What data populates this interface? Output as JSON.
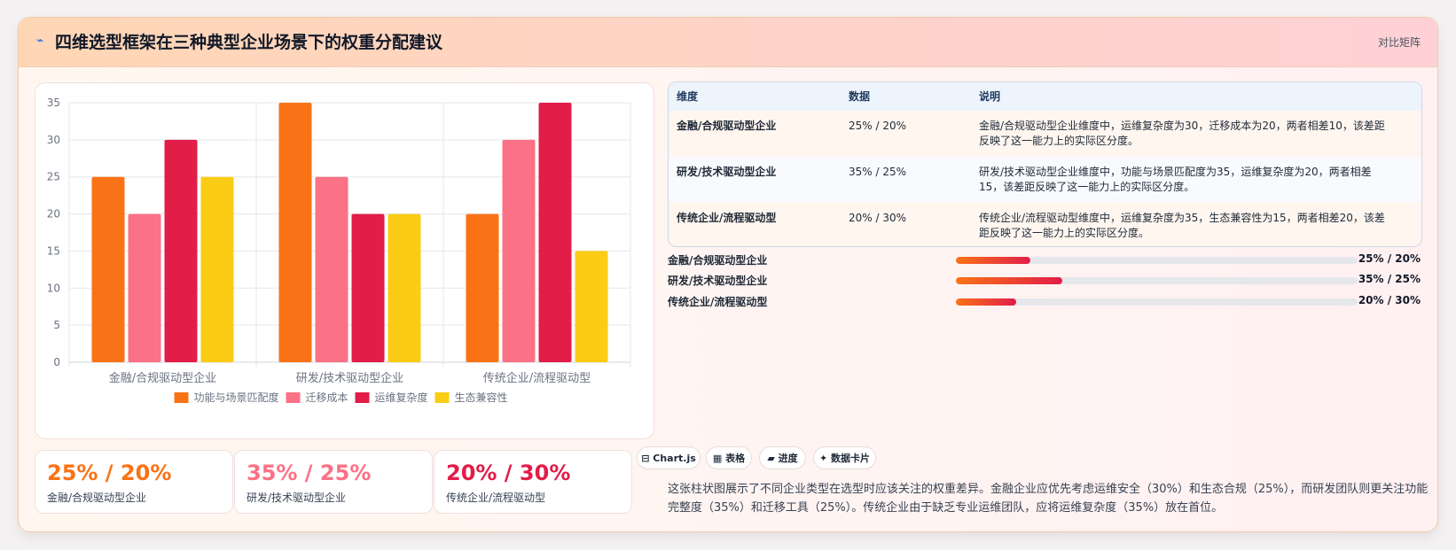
{
  "header": {
    "icon": "⌁",
    "title": "四维选型框架在三种典型企业场景下的权重分配建议",
    "tag": "对比矩阵"
  },
  "colors": {
    "orange": "#f97316",
    "pink": "#fb7185",
    "crimson": "#e11d48",
    "yellow": "#facc15"
  },
  "chart_data": {
    "type": "bar",
    "categories": [
      "金融/合规驱动型企业",
      "研发/技术驱动型企业",
      "传统企业/流程驱动型"
    ],
    "series": [
      {
        "name": "功能与场景匹配度",
        "values": [
          25,
          35,
          20
        ],
        "color": "#f97316"
      },
      {
        "name": "迁移成本",
        "values": [
          20,
          25,
          30
        ],
        "color": "#fb7185"
      },
      {
        "name": "运维复杂度",
        "values": [
          30,
          20,
          35
        ],
        "color": "#e11d48"
      },
      {
        "name": "生态兼容性",
        "values": [
          25,
          20,
          15
        ],
        "color": "#facc15"
      }
    ],
    "ylim": [
      0,
      35
    ],
    "yticks": [
      0,
      5,
      10,
      15,
      20,
      25,
      30,
      35
    ],
    "legend": "bottom",
    "grid": true
  },
  "kpis": [
    {
      "value": "25% / 20%",
      "label": "金融/合规驱动型企业",
      "color": "#f97316"
    },
    {
      "value": "35% / 25%",
      "label": "研发/技术驱动型企业",
      "color": "#fb7185"
    },
    {
      "value": "20% / 30%",
      "label": "传统企业/流程驱动型",
      "color": "#e11d48"
    }
  ],
  "table": {
    "headers": [
      "维度",
      "数据",
      "说明"
    ],
    "rows": [
      {
        "dim": "金融/合规驱动型企业",
        "data": "25% / 20%",
        "desc": "金融/合规驱动型企业维度中，运维复杂度为30，迁移成本为20，两者相差10，该差距反映了这一能力上的实际区分度。"
      },
      {
        "dim": "研发/技术驱动型企业",
        "data": "35% / 25%",
        "desc": "研发/技术驱动型企业维度中，功能与场景匹配度为35，运维复杂度为20，两者相差15，该差距反映了这一能力上的实际区分度。"
      },
      {
        "dim": "传统企业/流程驱动型",
        "data": "20% / 30%",
        "desc": "传统企业/流程驱动型维度中，运维复杂度为35，生态兼容性为15，两者相差20，该差距反映了这一能力上的实际区分度。"
      }
    ]
  },
  "progress": [
    {
      "label": "金融/合规驱动型企业",
      "value": "25% / 20%",
      "percent": 18.5
    },
    {
      "label": "研发/技术驱动型企业",
      "value": "35% / 25%",
      "percent": 26.5
    },
    {
      "label": "传统企业/流程驱动型",
      "value": "20% / 30%",
      "percent": 15
    }
  ],
  "tabs": [
    {
      "icon": "⊟",
      "label": "Chart.js"
    },
    {
      "icon": "▦",
      "label": "表格"
    },
    {
      "icon": "▰",
      "label": "进度"
    },
    {
      "icon": "✦",
      "label": "数据卡片"
    }
  ],
  "description": "这张柱状图展示了不同企业类型在选型时应该关注的权重差异。金融企业应优先考虑运维安全（30%）和生态合规（25%），而研发团队则更关注功能完整度（35%）和迁移工具（25%）。传统企业由于缺乏专业运维团队，应将运维复杂度（35%）放在首位。"
}
